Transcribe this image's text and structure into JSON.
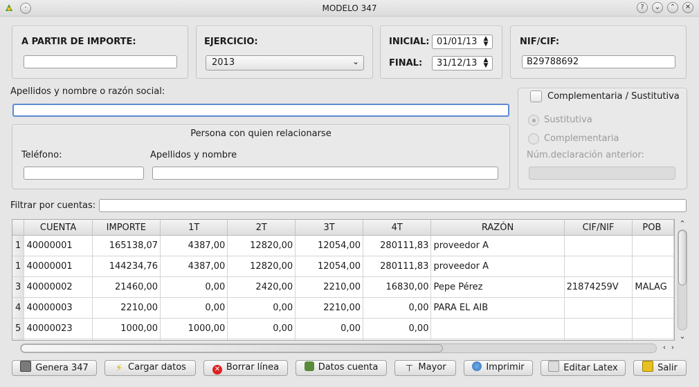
{
  "window": {
    "title": "MODELO 347"
  },
  "filters": {
    "importe_label": "A PARTIR DE IMPORTE:",
    "importe_value": "",
    "ejercicio_label": "EJERCICIO:",
    "ejercicio_value": "2013",
    "inicial_label": "INICIAL:",
    "inicial_value": "01/01/13",
    "final_label": "FINAL:",
    "final_value": "31/12/13",
    "nif_label": "NIF/CIF:",
    "nif_value": "B29788692"
  },
  "razon_social": {
    "label": "Apellidos y nombre o razón social:",
    "value": ""
  },
  "contacto": {
    "title": "Persona con quien relacionarse",
    "telefono_label": "Teléfono:",
    "telefono_value": "",
    "nombre_label": "Apellidos y nombre",
    "nombre_value": ""
  },
  "complementaria": {
    "checkbox_label": "Complementaria / Sustitutiva",
    "sustitutiva_label": "Sustitutiva",
    "complementaria_label": "Complementaria",
    "num_label": "Núm.declaración anterior:",
    "num_value": ""
  },
  "filtro": {
    "label": "Filtrar por cuentas:",
    "value": ""
  },
  "table": {
    "headers": [
      "CUENTA",
      "IMPORTE",
      "1T",
      "2T",
      "3T",
      "4T",
      "RAZÓN",
      "CIF/NIF",
      "POB"
    ],
    "rows": [
      {
        "n": "1",
        "cuenta": "40000001",
        "importe": "165138,07",
        "t1": "4387,00",
        "t2": "12820,00",
        "t3": "12054,00",
        "t4": "280111,83",
        "razon": "proveedor A",
        "cif": "",
        "pob": ""
      },
      {
        "n": "1",
        "cuenta": "40000001",
        "importe": "144234,76",
        "t1": "4387,00",
        "t2": "12820,00",
        "t3": "12054,00",
        "t4": "280111,83",
        "razon": "proveedor A",
        "cif": "",
        "pob": ""
      },
      {
        "n": "3",
        "cuenta": "40000002",
        "importe": "21460,00",
        "t1": "0,00",
        "t2": "2420,00",
        "t3": "2210,00",
        "t4": "16830,00",
        "razon": "Pepe Pérez",
        "cif": "21874259V",
        "pob": "MALAG"
      },
      {
        "n": "4",
        "cuenta": "40000003",
        "importe": "2210,00",
        "t1": "0,00",
        "t2": "0,00",
        "t3": "2210,00",
        "t4": "0,00",
        "razon": "PARA EL AIB",
        "cif": "",
        "pob": ""
      },
      {
        "n": "5",
        "cuenta": "40000023",
        "importe": "1000,00",
        "t1": "1000,00",
        "t2": "0,00",
        "t3": "0,00",
        "t4": "0,00",
        "razon": "",
        "cif": "",
        "pob": ""
      },
      {
        "n": "",
        "cuenta": "",
        "importe": "",
        "t1": "",
        "t2": "",
        "t3": "",
        "t4": "",
        "razon": "",
        "cif": "",
        "pob": ""
      }
    ]
  },
  "buttons": {
    "genera": "Genera 347",
    "cargar": "Cargar datos",
    "borrar": "Borrar línea",
    "datos": "Datos cuenta",
    "mayor": "Mayor",
    "imprimir": "Imprimir",
    "latex": "Editar Latex",
    "salir": "Salir"
  }
}
